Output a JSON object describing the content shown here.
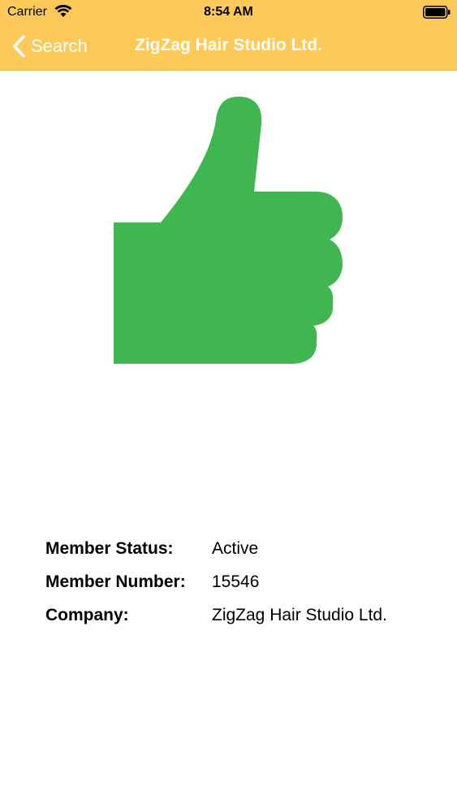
{
  "status_bar": {
    "carrier": "Carrier",
    "time": "8:54 AM",
    "wifi_icon": "wifi-icon",
    "battery_icon": "battery-icon"
  },
  "nav": {
    "back_label": "Search",
    "back_icon": "chevron-left-icon",
    "title": "ZigZag Hair Studio Ltd.",
    "bar_color": "#fdca5a"
  },
  "status_graphic": {
    "icon": "thumbs-up-icon",
    "color": "#3fb650"
  },
  "member": {
    "rows": [
      {
        "label": "Member Status:",
        "value": "Active"
      },
      {
        "label": "Member Number:",
        "value": "15546"
      },
      {
        "label": "Company:",
        "value": "ZigZag Hair Studio Ltd."
      }
    ]
  }
}
